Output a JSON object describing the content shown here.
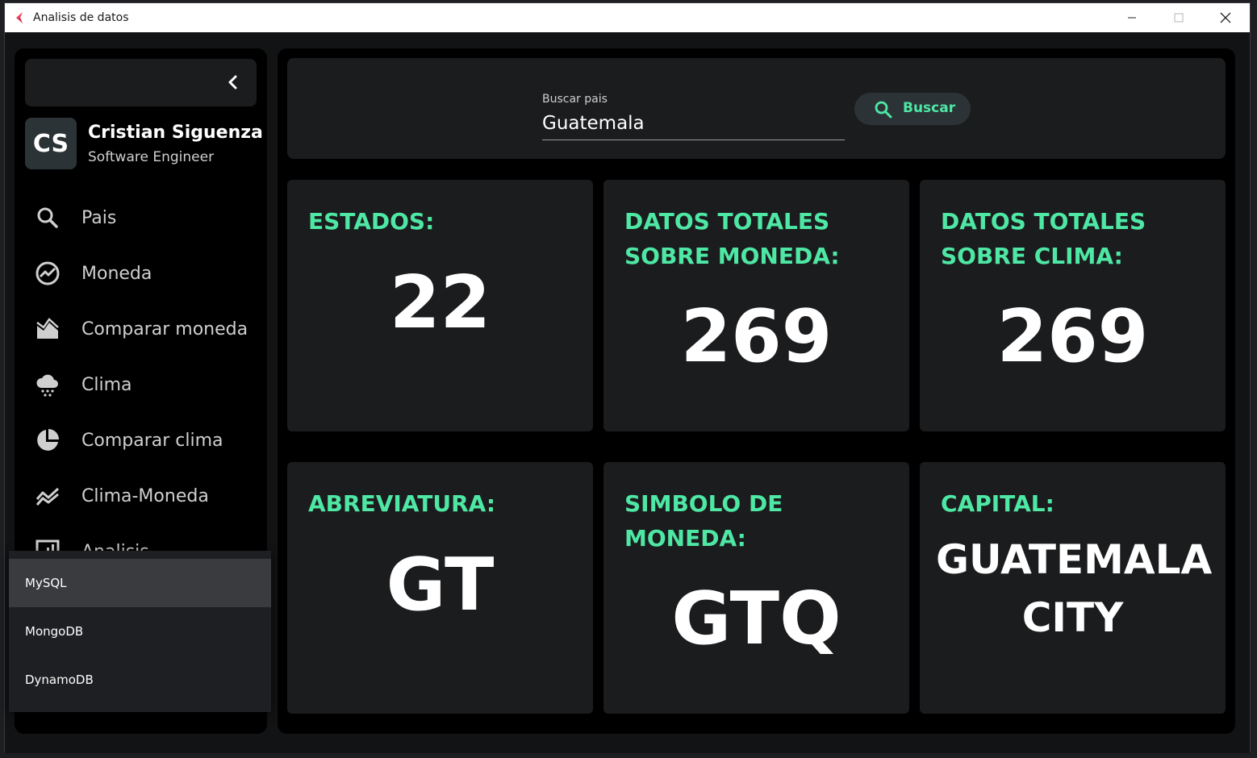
{
  "window": {
    "title": "Analisis de datos",
    "minimize_icon": "minimize-icon",
    "maximize_icon": "maximize-icon",
    "close_icon": "close-icon"
  },
  "sidebar": {
    "collapse_icon": "chevron-left-icon",
    "profile": {
      "initials": "CS",
      "name": "Cristian Siguenza",
      "role": "Software Engineer"
    },
    "items": [
      {
        "label": "Pais",
        "icon": "search-icon"
      },
      {
        "label": "Moneda",
        "icon": "chart-line-icon"
      },
      {
        "label": "Comparar moneda",
        "icon": "area-chart-icon"
      },
      {
        "label": "Clima",
        "icon": "cloud-snow-icon"
      },
      {
        "label": "Comparar clima",
        "icon": "pie-chart-icon"
      },
      {
        "label": "Clima-Moneda",
        "icon": "trend-lines-icon"
      },
      {
        "label": "Analisis",
        "icon": "bar-chart-icon"
      }
    ]
  },
  "db_dropdown": {
    "options": [
      "MySQL",
      "MongoDB",
      "DynamoDB"
    ],
    "selected": "MySQL"
  },
  "search": {
    "label": "Buscar pais",
    "value": "Guatemala",
    "button_label": "Buscar",
    "button_icon": "search-icon"
  },
  "cards": [
    {
      "title": "ESTADOS:",
      "value": "22"
    },
    {
      "title": "DATOS TOTALES SOBRE MONEDA:",
      "value": "269"
    },
    {
      "title": "DATOS TOTALES SOBRE CLIMA:",
      "value": "269"
    },
    {
      "title": "ABREVIATURA:",
      "value": "GT"
    },
    {
      "title": "SIMBOLO DE MONEDA:",
      "value": "GTQ"
    },
    {
      "title": "CAPITAL:",
      "value": "GUATEMALA CITY"
    }
  ],
  "colors": {
    "accent": "#4ee7a4",
    "background": "#121314",
    "panel": "#1b1c1e",
    "sidebar": "#000000"
  }
}
